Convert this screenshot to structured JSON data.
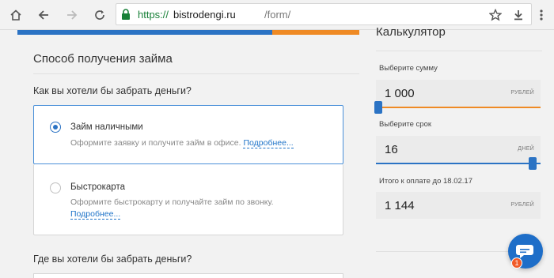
{
  "browser": {
    "url_secure": "https://",
    "url_host": "bistrodengi.ru",
    "url_path": "/form/"
  },
  "colors": {
    "accent_blue": "#2b73c4",
    "accent_orange": "#ef8a24",
    "link_blue": "#1e73c8"
  },
  "form": {
    "section_title": "Способ получения займа",
    "question": "Как вы хотели бы забрать деньги?",
    "options": [
      {
        "title": "Займ наличными",
        "description": "Оформите заявку и получите займ в офисе.",
        "link": "Подробнее...",
        "selected": true
      },
      {
        "title": "Быстрокарта",
        "description": "Оформите быстрокарту и получайте займ по звонку.",
        "link": "Подробнее...",
        "selected": false
      }
    ],
    "question2": "Где вы хотели бы забрать деньги?"
  },
  "calculator": {
    "title": "Калькулятор",
    "amount_label": "Выберите сумму",
    "amount_value": "1 000",
    "amount_unit": "РУБЛЕЙ",
    "term_label": "Выберите срок",
    "term_value": "16",
    "term_unit": "ДНЕЙ",
    "total_label": "Итого к оплате до 18.02.17",
    "total_value": "1 144",
    "total_unit": "РУБЛЕЙ"
  },
  "chat": {
    "badge_count": "1"
  }
}
